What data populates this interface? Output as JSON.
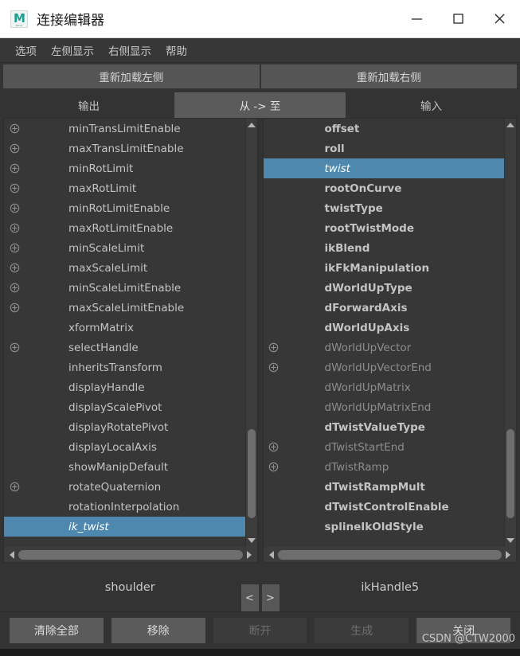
{
  "window": {
    "title": "连接编辑器",
    "app_icon": "maya-m-icon",
    "icon_sub": "MAYA",
    "controls": [
      {
        "name": "minimize-button",
        "glyph": "minimize-icon"
      },
      {
        "name": "maximize-button",
        "glyph": "maximize-icon"
      },
      {
        "name": "close-button",
        "glyph": "close-icon"
      }
    ]
  },
  "menubar": {
    "items": [
      {
        "label": "选项"
      },
      {
        "label": "左侧显示"
      },
      {
        "label": "右侧显示"
      },
      {
        "label": "帮助"
      }
    ]
  },
  "reload": {
    "left_label": "重新加载左侧",
    "right_label": "重新加载右侧"
  },
  "tabs": [
    {
      "label": "输出",
      "active": false
    },
    {
      "label": "从 -> 至",
      "active": true
    },
    {
      "label": "输入",
      "active": false
    }
  ],
  "left_panel": {
    "node_name": "shoulder",
    "items": [
      {
        "label": "minTransLimitEnable",
        "expandable": true,
        "selected": false,
        "dim": false
      },
      {
        "label": "maxTransLimitEnable",
        "expandable": true,
        "selected": false,
        "dim": false
      },
      {
        "label": "minRotLimit",
        "expandable": true,
        "selected": false,
        "dim": false
      },
      {
        "label": "maxRotLimit",
        "expandable": true,
        "selected": false,
        "dim": false
      },
      {
        "label": "minRotLimitEnable",
        "expandable": true,
        "selected": false,
        "dim": false
      },
      {
        "label": "maxRotLimitEnable",
        "expandable": true,
        "selected": false,
        "dim": false
      },
      {
        "label": "minScaleLimit",
        "expandable": true,
        "selected": false,
        "dim": false
      },
      {
        "label": "maxScaleLimit",
        "expandable": true,
        "selected": false,
        "dim": false
      },
      {
        "label": "minScaleLimitEnable",
        "expandable": true,
        "selected": false,
        "dim": false
      },
      {
        "label": "maxScaleLimitEnable",
        "expandable": true,
        "selected": false,
        "dim": false
      },
      {
        "label": "xformMatrix",
        "expandable": false,
        "selected": false,
        "dim": false
      },
      {
        "label": "selectHandle",
        "expandable": true,
        "selected": false,
        "dim": false
      },
      {
        "label": "inheritsTransform",
        "expandable": false,
        "selected": false,
        "dim": false
      },
      {
        "label": "displayHandle",
        "expandable": false,
        "selected": false,
        "dim": false
      },
      {
        "label": "displayScalePivot",
        "expandable": false,
        "selected": false,
        "dim": false
      },
      {
        "label": "displayRotatePivot",
        "expandable": false,
        "selected": false,
        "dim": false
      },
      {
        "label": "displayLocalAxis",
        "expandable": false,
        "selected": false,
        "dim": false
      },
      {
        "label": "showManipDefault",
        "expandable": false,
        "selected": false,
        "dim": false
      },
      {
        "label": "rotateQuaternion",
        "expandable": true,
        "selected": false,
        "dim": false
      },
      {
        "label": "rotationInterpolation",
        "expandable": false,
        "selected": false,
        "dim": false
      },
      {
        "label": "ik_twist",
        "expandable": false,
        "selected": true,
        "dim": false
      }
    ],
    "vscroll": {
      "thumb_top_pct": 74,
      "thumb_height_pct": 22
    },
    "hscroll": {
      "thumb_left_pct": 0,
      "thumb_width_pct": 100
    }
  },
  "right_panel": {
    "node_name": "ikHandle5",
    "items": [
      {
        "label": "offset",
        "expandable": false,
        "selected": false,
        "dim": false
      },
      {
        "label": "roll",
        "expandable": false,
        "selected": false,
        "dim": false
      },
      {
        "label": "twist",
        "expandable": false,
        "selected": true,
        "dim": false
      },
      {
        "label": "rootOnCurve",
        "expandable": false,
        "selected": false,
        "dim": false
      },
      {
        "label": "twistType",
        "expandable": false,
        "selected": false,
        "dim": false
      },
      {
        "label": "rootTwistMode",
        "expandable": false,
        "selected": false,
        "dim": false
      },
      {
        "label": "ikBlend",
        "expandable": false,
        "selected": false,
        "dim": false
      },
      {
        "label": "ikFkManipulation",
        "expandable": false,
        "selected": false,
        "dim": false
      },
      {
        "label": "dWorldUpType",
        "expandable": false,
        "selected": false,
        "dim": false
      },
      {
        "label": "dForwardAxis",
        "expandable": false,
        "selected": false,
        "dim": false
      },
      {
        "label": "dWorldUpAxis",
        "expandable": false,
        "selected": false,
        "dim": false
      },
      {
        "label": "dWorldUpVector",
        "expandable": true,
        "selected": false,
        "dim": true
      },
      {
        "label": "dWorldUpVectorEnd",
        "expandable": true,
        "selected": false,
        "dim": true
      },
      {
        "label": "dWorldUpMatrix",
        "expandable": false,
        "selected": false,
        "dim": true
      },
      {
        "label": "dWorldUpMatrixEnd",
        "expandable": false,
        "selected": false,
        "dim": true
      },
      {
        "label": "dTwistValueType",
        "expandable": false,
        "selected": false,
        "dim": false
      },
      {
        "label": "dTwistStartEnd",
        "expandable": true,
        "selected": false,
        "dim": true
      },
      {
        "label": "dTwistRamp",
        "expandable": true,
        "selected": false,
        "dim": true
      },
      {
        "label": "dTwistRampMult",
        "expandable": false,
        "selected": false,
        "dim": false
      },
      {
        "label": "dTwistControlEnable",
        "expandable": false,
        "selected": false,
        "dim": false
      },
      {
        "label": "splineIkOldStyle",
        "expandable": false,
        "selected": false,
        "dim": false
      }
    ],
    "vscroll": {
      "thumb_top_pct": 74,
      "thumb_height_pct": 22
    },
    "hscroll": {
      "thumb_left_pct": 0,
      "thumb_width_pct": 100
    }
  },
  "transfer": {
    "left_arrow_label": "<",
    "right_arrow_label": ">"
  },
  "footer": {
    "buttons": [
      {
        "label": "清除全部",
        "disabled": false
      },
      {
        "label": "移除",
        "disabled": false
      },
      {
        "label": "断开",
        "disabled": true
      },
      {
        "label": "生成",
        "disabled": true
      },
      {
        "label": "关闭",
        "disabled": false
      }
    ]
  },
  "watermark": "CSDN @CTW2000",
  "colors": {
    "selection_blue": "#4f88ae",
    "panel_bg": "#373737",
    "window_bg": "#333333",
    "button_bg": "#5b5b5b",
    "text": "#c3c3c3",
    "dim_text": "#8d8d8d"
  }
}
